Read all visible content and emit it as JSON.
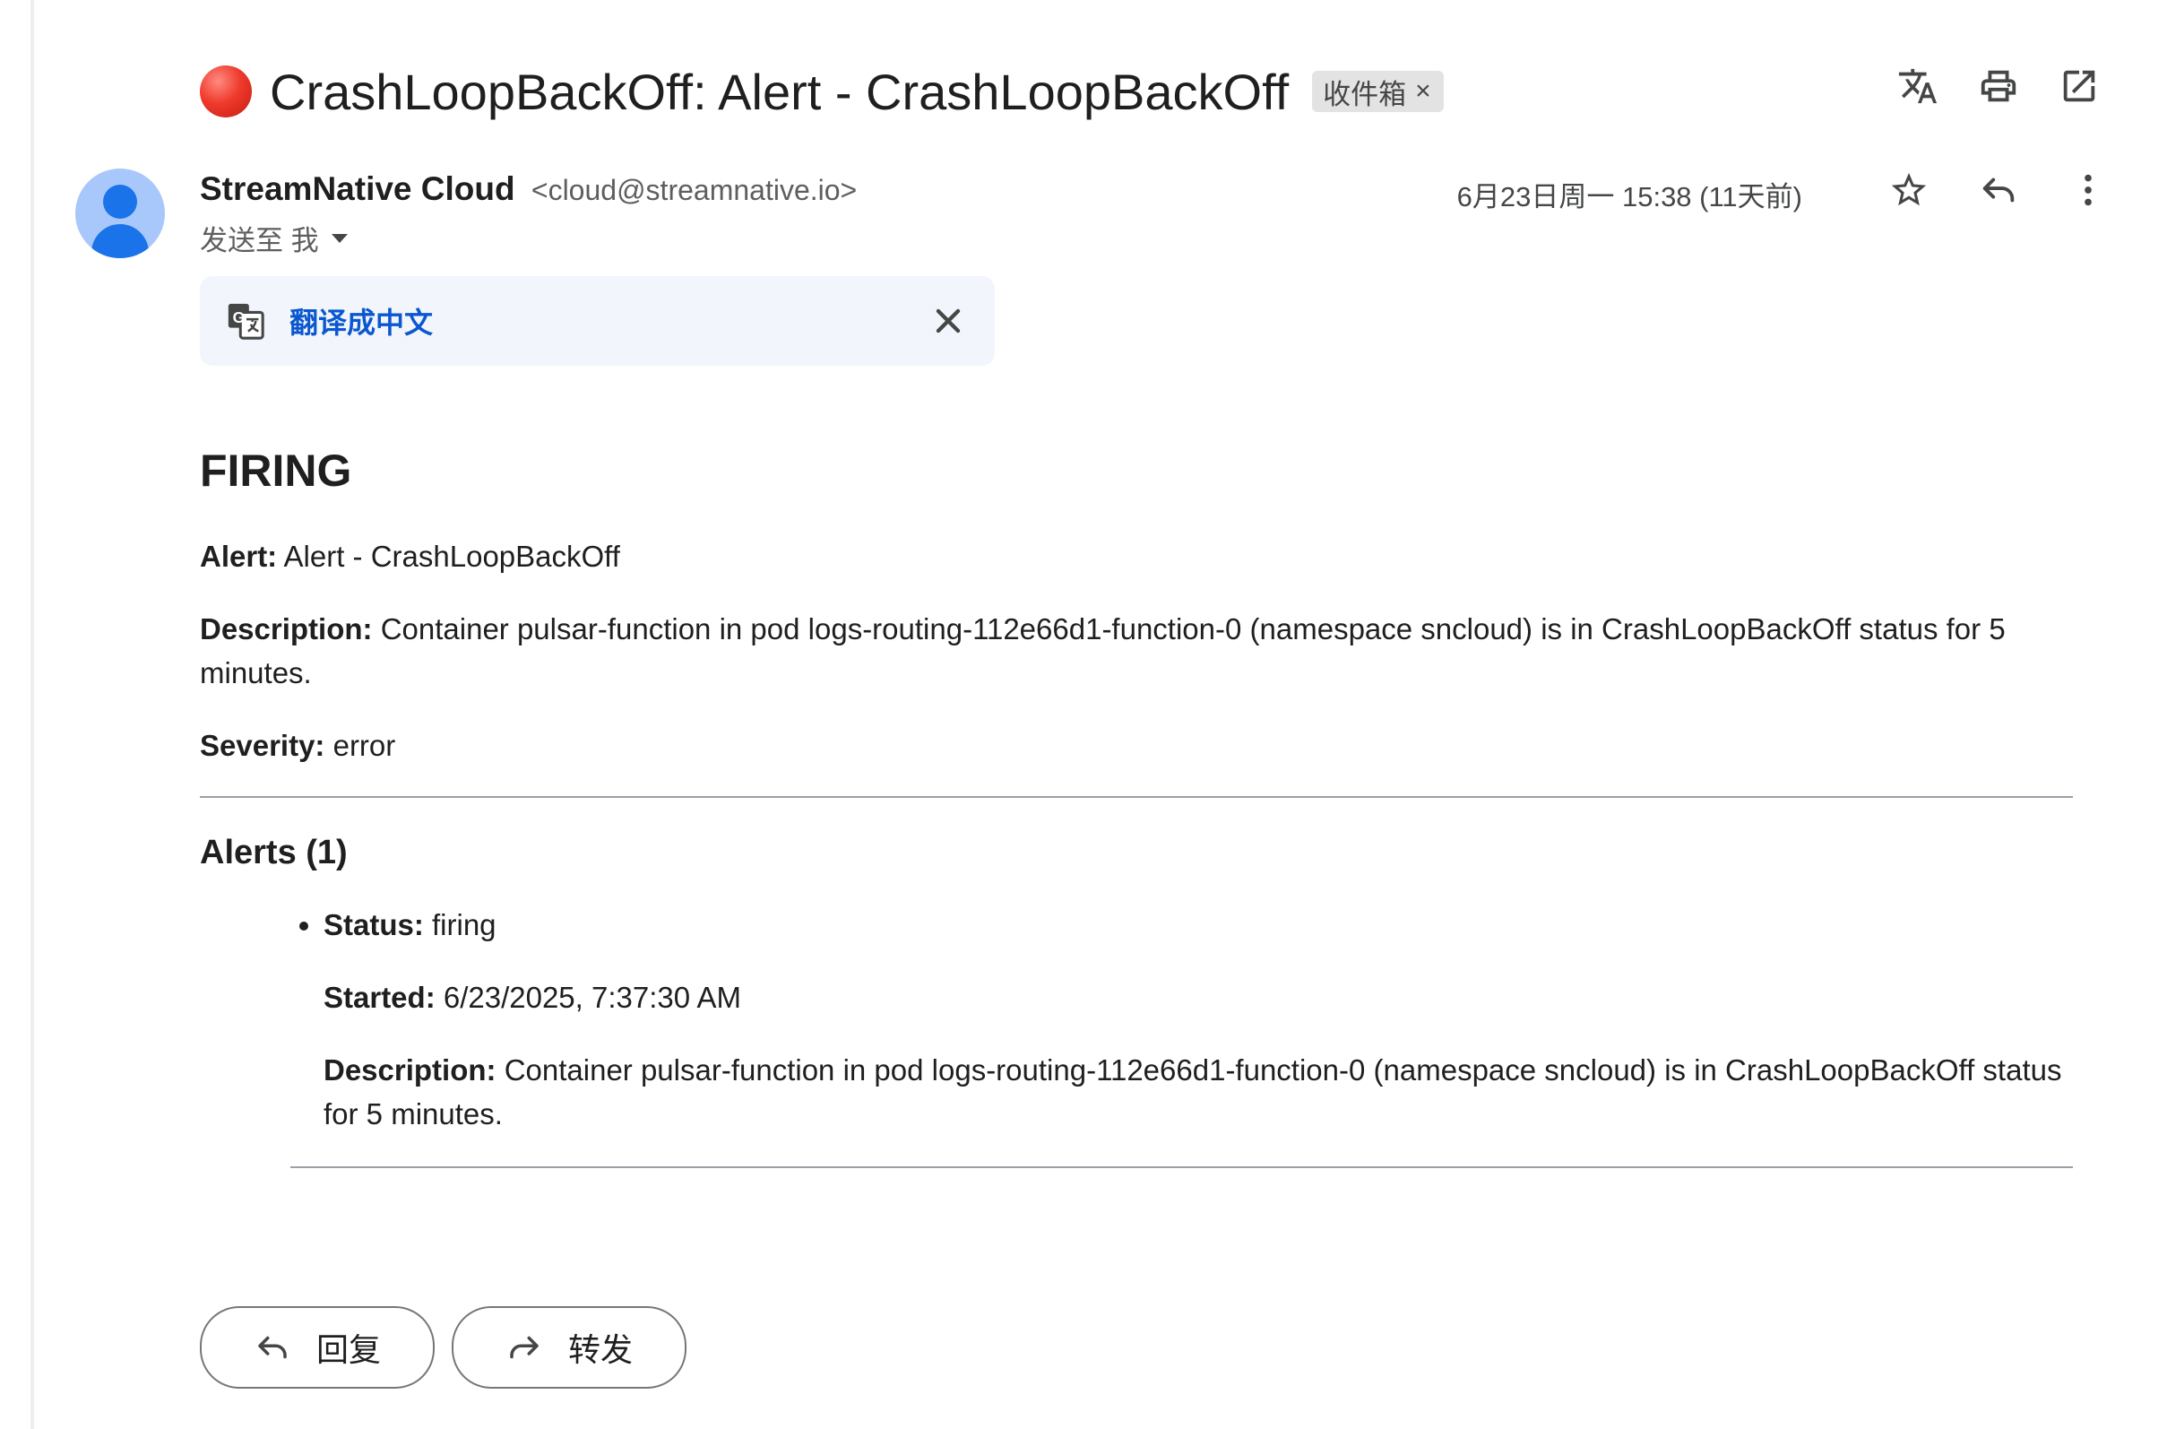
{
  "email": {
    "subject": "CrashLoopBackOff: Alert - CrashLoopBackOff",
    "label": "收件箱",
    "label_remove": "×",
    "sender_name": "StreamNative Cloud",
    "sender_email": "<cloud@streamnative.io>",
    "to_line": "发送至 我",
    "date": "6月23日周一 15:38 (11天前)"
  },
  "translate_bar": {
    "link": "翻译成中文"
  },
  "body": {
    "heading": "FIRING",
    "alert_label": "Alert:",
    "alert_value": " Alert - CrashLoopBackOff",
    "description_label": "Description:",
    "description_value": " Container pulsar-function in pod logs-routing-112e66d1-function-0 (namespace sncloud) is in CrashLoopBackOff status for 5 minutes.",
    "severity_label": "Severity:",
    "severity_value": " error",
    "alerts_heading": "Alerts (1)",
    "alerts": [
      {
        "status_label": "Status:",
        "status_value": " firing",
        "started_label": "Started:",
        "started_value": " 6/23/2025, 7:37:30 AM",
        "description_label": "Description:",
        "description_value": " Container pulsar-function in pod logs-routing-112e66d1-function-0 (namespace sncloud) is in CrashLoopBackOff status for 5 minutes."
      }
    ]
  },
  "actions": {
    "reply": "回复",
    "forward": "转发"
  },
  "icons": {
    "subject_marker": "red-circle-icon",
    "top": [
      "translate-icon",
      "print-icon",
      "open-in-new-window-icon"
    ],
    "header": [
      "star-icon",
      "reply-icon",
      "more-vert-icon"
    ]
  },
  "colors": {
    "link": "#0b57d0",
    "avatar_bg": "#a8c7fa",
    "avatar_fg": "#1a73e8",
    "translate_bar_bg": "#f2f6fc",
    "chip_bg": "#e3e3e3"
  }
}
